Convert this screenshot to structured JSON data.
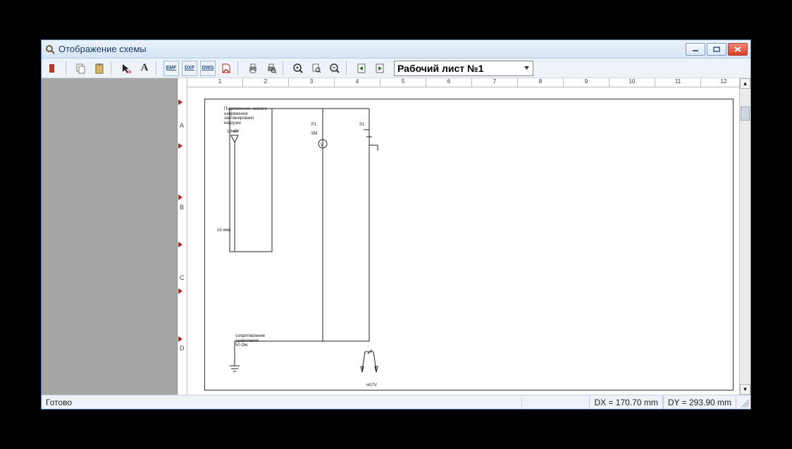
{
  "window": {
    "title": "Отображение схемы"
  },
  "toolbar": {
    "exports": [
      "EMF",
      "DXF",
      "DWG"
    ],
    "sheet_selected": "Рабочий лист №1"
  },
  "ruler": {
    "cols": [
      "1",
      "2",
      "3",
      "4",
      "5",
      "6",
      "7",
      "8",
      "9",
      "10",
      "11",
      "12"
    ],
    "rows": [
      "A",
      "B",
      "C",
      "D"
    ]
  },
  "schematic": {
    "note_top": "Подключение низкого\nнапряжения запланировано\nнагрузки",
    "power": "12 кВт",
    "p1": "P1",
    "s1": "S1",
    "voltmeter_sub": "5М",
    "wire_gauge": "16 кмм",
    "ground_note": "сопритявление\nзаземления\n50 Ом",
    "bottom_label": "H07V"
  },
  "status": {
    "ready": "Готово",
    "dx": "DX = 170.70 mm",
    "dy": "DY = 293.90 mm"
  }
}
